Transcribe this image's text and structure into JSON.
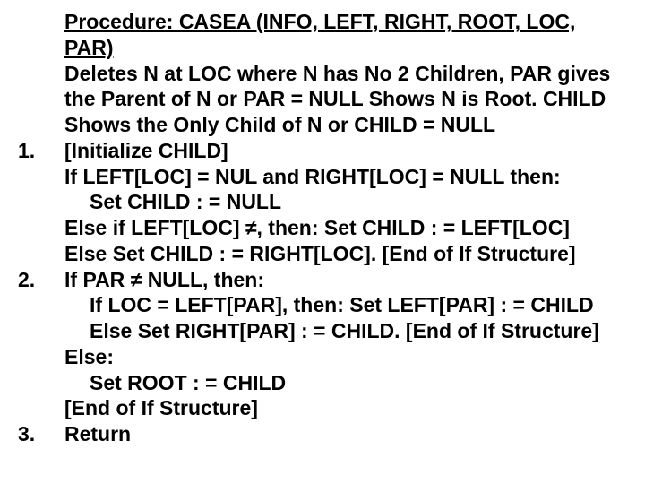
{
  "title": "Procedure: CASEA (INFO, LEFT, RIGHT, ROOT, LOC, PAR)",
  "desc": "Deletes N at LOC where N has No 2 Children, PAR gives the Parent of N or PAR = NULL Shows N is Root. CHILD Shows the Only Child of N or CHILD = NULL",
  "n1": "1.",
  "n2": "2.",
  "n3": "3.",
  "s1": {
    "l1": "[Initialize CHILD]",
    "l2": "If LEFT[LOC] = NUL and RIGHT[LOC] = NULL then:",
    "l3": "Set CHILD : = NULL",
    "l4": "Else if LEFT[LOC] ≠, then:   Set CHILD : = LEFT[LOC]",
    "l5": "Else Set CHILD : = RIGHT[LOC]. [End of If Structure]"
  },
  "s2": {
    "l1": "If PAR ≠ NULL, then:",
    "l2": "If LOC = LEFT[PAR], then: Set LEFT[PAR] : = CHILD",
    "l3": "Else Set RIGHT[PAR] : = CHILD. [End of If Structure]",
    "l4": "Else:",
    "l5": "Set ROOT : = CHILD",
    "l6": "[End of If Structure]"
  },
  "s3": {
    "l1": "Return"
  }
}
